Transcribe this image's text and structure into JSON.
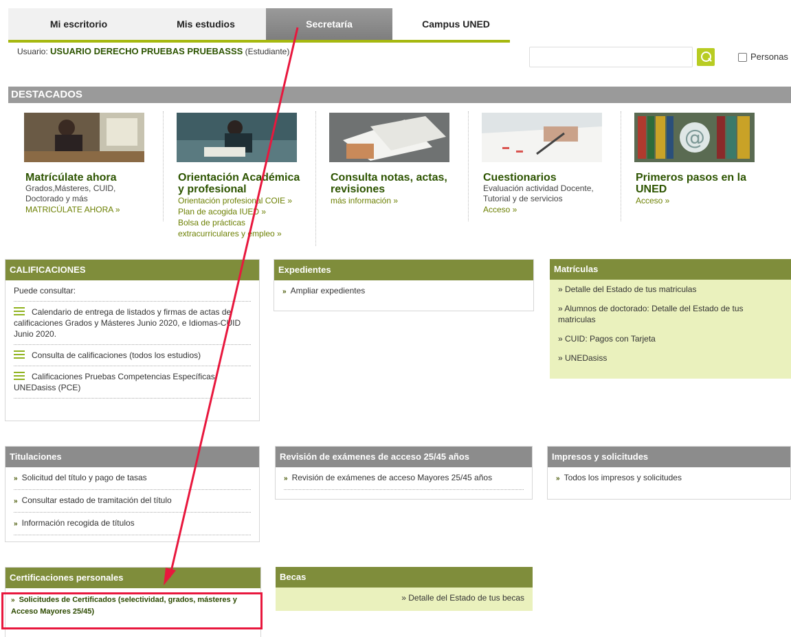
{
  "nav": {
    "tabs": [
      {
        "label": "Mi escritorio",
        "active": false
      },
      {
        "label": "Mis estudios",
        "active": false
      },
      {
        "label": "Secretaría",
        "active": true
      },
      {
        "label": "Campus UNED",
        "active": false
      }
    ]
  },
  "user": {
    "prefix": "Usuario:",
    "name": "USUARIO DERECHO PRUEBAS PRUEBASSS",
    "role": "(Estudiante)"
  },
  "search": {
    "value": "",
    "checkbox_label": "Personas",
    "checked": false
  },
  "destacados": {
    "title": "DESTACADOS",
    "items": [
      {
        "title": "Matrícúlate ahora",
        "lines": [
          "Grados,Másteres, CUID,",
          "Doctorado y más"
        ],
        "links": [
          "MATRICÚLATE AHORA »"
        ]
      },
      {
        "title": "Orientación Académica y profesional",
        "lines": [],
        "links": [
          "Orientación profesional COIE »",
          "Plan de acogida IUED »",
          "Bolsa de prácticas",
          "extracurriculares y empleo »"
        ]
      },
      {
        "title": "Consulta notas, actas, revisiones",
        "lines": [],
        "links": [
          "más información »"
        ]
      },
      {
        "title": "Cuestionarios",
        "lines": [
          "Evaluación actividad Docente,",
          "Tutorial y de servicios"
        ],
        "links": [
          "Acceso »"
        ]
      },
      {
        "title": "Primeros pasos en la UNED",
        "lines": [],
        "links": [
          "Acceso »"
        ]
      }
    ]
  },
  "calificaciones": {
    "title": "CALIFICACIONES",
    "intro": "Puede consultar:",
    "items": [
      "Calendario de entrega de listados y firmas de actas de calificaciones Grados y Másteres Junio 2020, e Idiomas-CUID Junio 2020.",
      "Consulta de calificaciones (todos los estudios)",
      "Calificaciones Pruebas Competencias Específicas UNEDasiss (PCE)"
    ]
  },
  "expedientes": {
    "title": "Expedientes",
    "items": [
      "Ampliar expedientes"
    ]
  },
  "matriculas": {
    "title": "Matrículas",
    "items": [
      "» Detalle del Estado de tus matriculas",
      "» Alumnos de doctorado: Detalle del Estado de tus matriculas",
      "» CUID: Pagos con Tarjeta",
      "» UNEDasiss"
    ]
  },
  "titulaciones": {
    "title": "Titulaciones",
    "items": [
      "Solicitud del título y pago de tasas",
      "Consultar estado de tramitación del título",
      "Información recogida de títulos"
    ]
  },
  "revision": {
    "title": "Revisión de exámenes de acceso 25/45 años",
    "items": [
      "Revisión de exámenes de acceso Mayores 25/45 años"
    ]
  },
  "impresos": {
    "title": "Impresos y solicitudes",
    "items": [
      "Todos los impresos y solicitudes"
    ]
  },
  "certificaciones": {
    "title": "Certificaciones personales",
    "items": [
      "Solicitudes de Certificados (selectividad, grados, másteres y Acceso Mayores 25/45)"
    ]
  },
  "becas": {
    "title": "Becas",
    "items": [
      "» Detalle del Estado de tus becas"
    ]
  },
  "colors": {
    "green_header": "#7f8d3b",
    "grey_header": "#8c8c8c",
    "light_green": "#eaf1bd",
    "accent_line": "#a6b80f",
    "annotation_red": "#e8173d"
  }
}
